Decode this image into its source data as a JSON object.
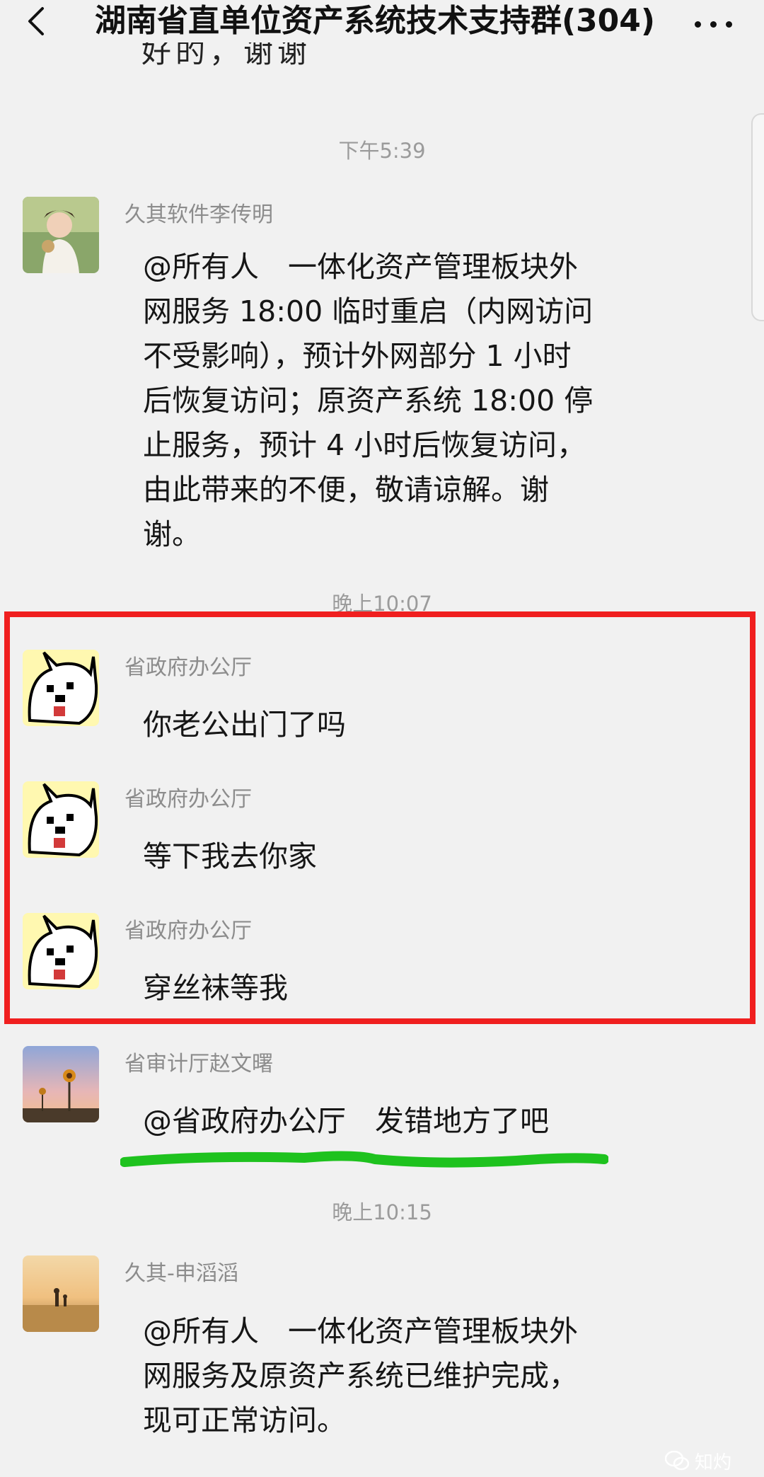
{
  "header": {
    "back_icon": "chevron-left-icon",
    "title": "湖南省直单位资产系统技术支持群(304)",
    "more_icon": "more-dots-icon"
  },
  "partial_top_text": "好的，谢谢",
  "timestamps": [
    "下午5:39",
    "晚上10:07",
    "晚上10:15"
  ],
  "messages": [
    {
      "sender": "久其软件李传明",
      "avatar": "avatar-girl-photo",
      "lines": [
        "@所有人　一体化资产管理板块外",
        "网服务 18:00 临时重启（内网访问",
        "不受影响），预计外网部分 1 小时",
        "后恢复访问；原资产系统 18:00 停",
        "止服务，预计 4 小时后恢复访问，",
        "由此带来的不便，敬请谅解。谢",
        "谢。"
      ]
    },
    {
      "sender": "省政府办公厅",
      "avatar": "avatar-cartoon-dog",
      "text": "你老公出门了吗"
    },
    {
      "sender": "省政府办公厅",
      "avatar": "avatar-cartoon-dog",
      "text": "等下我去你家"
    },
    {
      "sender": "省政府办公厅",
      "avatar": "avatar-cartoon-dog",
      "text": "穿丝袜等我"
    },
    {
      "sender": "省审计厅赵文曙",
      "avatar": "avatar-sunflower-sunset",
      "text": "@省政府办公厅　发错地方了吧"
    },
    {
      "sender": "久其-申滔滔",
      "avatar": "avatar-field-sunset",
      "lines": [
        "@所有人　一体化资产管理板块外",
        "网服务及原资产系统已维护完成，",
        "现可正常访问。"
      ]
    }
  ],
  "annotations": {
    "highlight_color": "#f01f1f",
    "underline_color": "#1ec21e"
  },
  "watermark": {
    "icon": "wechat-icon",
    "text": "知灼"
  }
}
